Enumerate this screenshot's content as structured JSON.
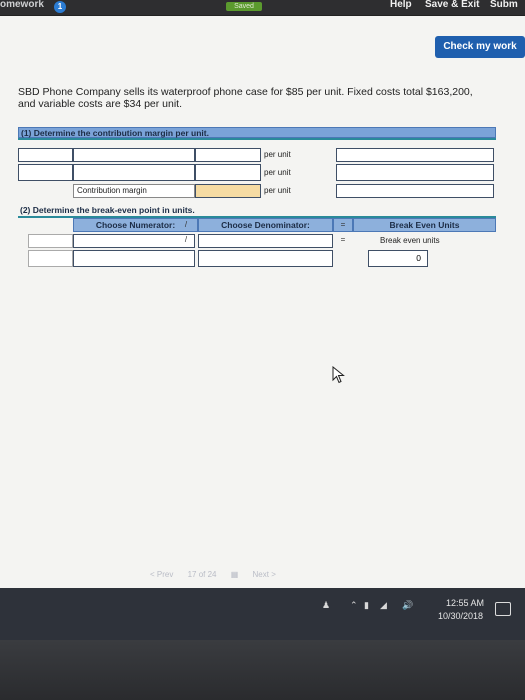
{
  "header": {
    "app_title": "omework",
    "badge": "1",
    "saved_label": "Saved",
    "help_label": "Help",
    "save_exit_label": "Save & Exit",
    "submit_label": "Subm"
  },
  "check_my_work_label": "Check my work",
  "problem": {
    "line1": "SBD Phone Company sells its waterproof phone case for $85 per unit. Fixed costs total $163,200,",
    "line2": "and variable costs are $34 per unit."
  },
  "part1": {
    "heading": "(1) Determine the contribution margin per unit.",
    "rows": [
      {
        "unit": "per unit",
        "label": ""
      },
      {
        "unit": "per unit",
        "label": ""
      },
      {
        "unit": "per unit",
        "label": "Contribution margin"
      }
    ]
  },
  "part2": {
    "heading": "(2) Determine the break-even point in units.",
    "numerator_label": "Choose Numerator:",
    "divide_symbol": "/",
    "denominator_label": "Choose Denominator:",
    "equals_symbol": "=",
    "result_header": "Break Even Units",
    "result_subheader": "Break even units",
    "result_value": "0"
  },
  "pager": {
    "prev": "< Prev",
    "page": "17 of 24",
    "next": "Next >"
  },
  "taskbar": {
    "time": "12:55 AM",
    "date": "10/30/2018"
  }
}
